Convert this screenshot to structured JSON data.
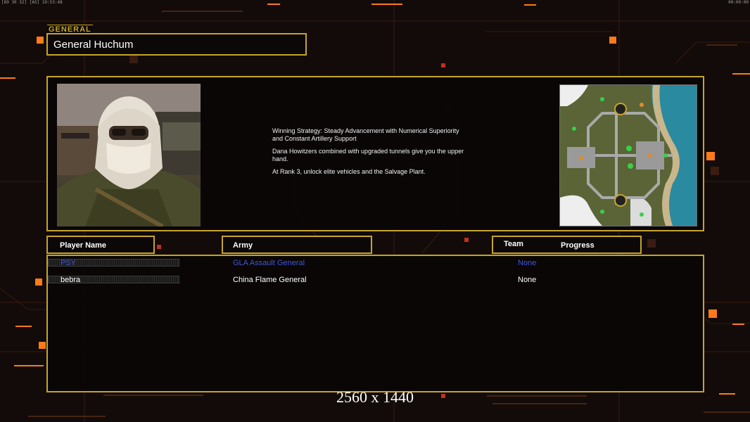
{
  "status_bar": {
    "left_text": "19:53:48",
    "left_prefix": "[89 30 32] [AS]",
    "right_text": "00:00:00"
  },
  "header": {
    "tag": "GENERAL",
    "title": "General Huchum"
  },
  "strategy": {
    "lines": [
      "Winning Strategy: Steady Advancement with Numerical Superiority\n and Constant Artillery Support",
      "Dana Howitzers combined with upgraded tunnels give you the upper\n hand.",
      "At Rank 3, unlock elite vehicles and the Salvage Plant."
    ]
  },
  "columns": {
    "player": "Player Name",
    "army": "Army",
    "team": "Team",
    "progress": "Progress"
  },
  "players": [
    {
      "name": "PSY",
      "army": "GLA Assault General",
      "team": "None",
      "progress": 0,
      "color": "#3f56d6"
    },
    {
      "name": "bebra",
      "army": "China Flame General",
      "team": "None",
      "progress": 0,
      "color": "#ffffff"
    }
  ],
  "overlay": {
    "resolution": "2560 x 1440"
  },
  "colors": {
    "gold": "#c7a427",
    "accent_orange": "#ff7a1a",
    "background": "#120b09"
  }
}
